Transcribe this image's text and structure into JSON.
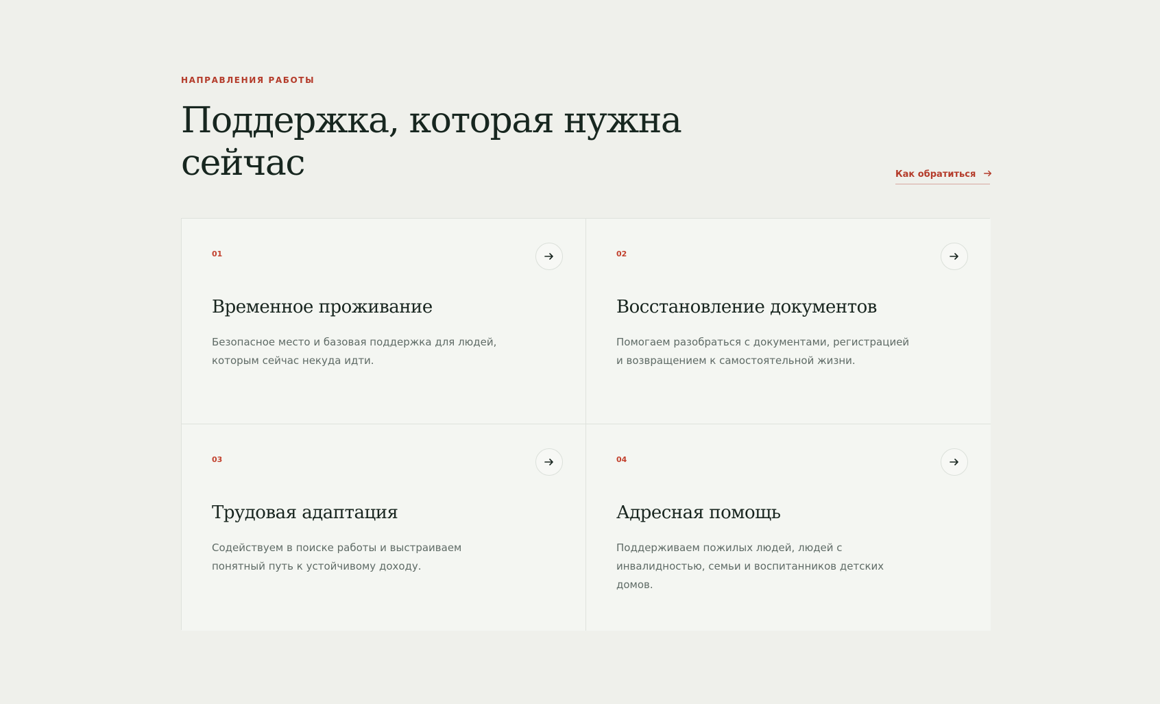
{
  "section": {
    "eyebrow": "НАПРАВЛЕНИЯ РАБОТЫ",
    "title": "Поддержка, которая нужна сейчас",
    "link_label": "Как обратиться",
    "link_icon": "arrow-right-icon"
  },
  "colors": {
    "page_background": "#eff0eb",
    "card_background": "#f4f6f2",
    "accent": "#b43b2a",
    "heading": "#17261f",
    "body_text": "#5f6b66",
    "border": "#dfe2dd"
  },
  "cards": [
    {
      "number": "01",
      "title": "Временное проживание",
      "text": "Безопасное место и базовая поддержка для людей, которым сейчас некуда идти.",
      "icon": "arrow-right-icon"
    },
    {
      "number": "02",
      "title": "Восстановление документов",
      "text": "Помогаем разобраться с документами, регистрацией и возвращением к самостоятельной жизни.",
      "icon": "arrow-right-icon"
    },
    {
      "number": "03",
      "title": "Трудовая адаптация",
      "text": "Содействуем в поиске работы и выстраиваем понятный путь к устойчивому доходу.",
      "icon": "arrow-right-icon"
    },
    {
      "number": "04",
      "title": "Адресная помощь",
      "text": "Поддерживаем пожилых людей, людей с инвалидностью, семьи и воспитанников детских домов.",
      "icon": "arrow-right-icon"
    }
  ]
}
